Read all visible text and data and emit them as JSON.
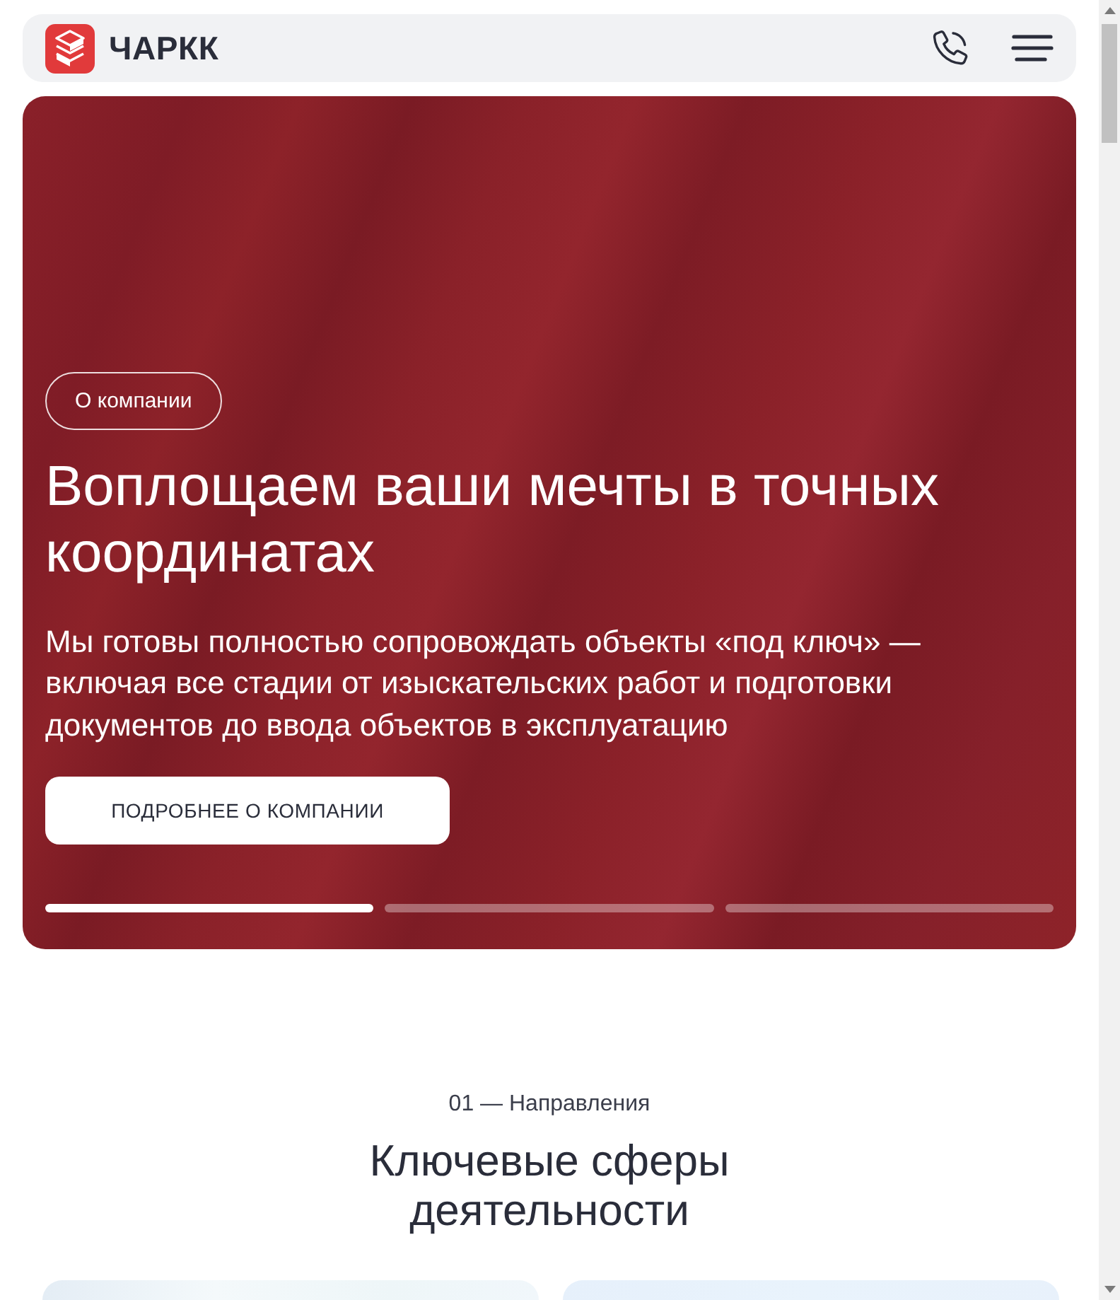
{
  "header": {
    "logo_text": "ЧАРКК"
  },
  "hero": {
    "badge": "О компании",
    "title": "Воплощаем ваши мечты в точных координатах",
    "text": "Мы готовы полностью сопровождать объекты «под ключ» — включая все стадии от изыскательских работ и подготовки документов до ввода объектов в эксплуатацию",
    "button": "ПОДРОБНЕЕ О КОМПАНИИ",
    "slides": [
      {
        "selected": true
      },
      {
        "selected": false
      },
      {
        "selected": false
      }
    ]
  },
  "section": {
    "eyebrow": "01 — Направления",
    "title": "Ключевые сферы деятельности"
  }
}
